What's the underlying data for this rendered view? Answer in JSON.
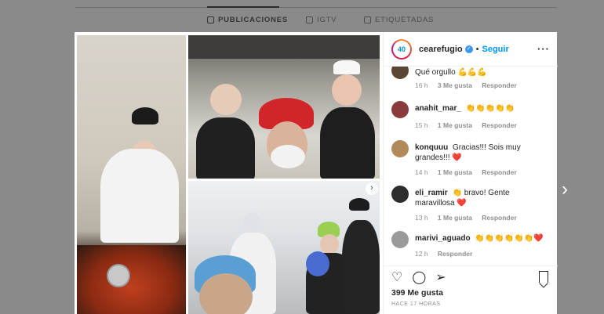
{
  "profile_tabs": {
    "publications": "PUBLICACIONES",
    "igtv": "IGTV",
    "tagged": "ETIQUETADAS"
  },
  "post": {
    "header": {
      "avatar_text": "40",
      "username": "cearefugio",
      "verified_glyph": "✓",
      "separator": "•",
      "follow_label": "Seguir",
      "more_glyph": "···"
    },
    "comments": [
      {
        "username": "",
        "text": "Qué orgullo 💪💪💪",
        "time": "16 h",
        "likes": "3 Me gusta",
        "reply": "Responder",
        "avatar_color": "#5a4634"
      },
      {
        "username": "anahit_mar_",
        "text": "👏👏👏👏👏",
        "time": "15 h",
        "likes": "1 Me gusta",
        "reply": "Responder",
        "avatar_color": "#8a3b3b"
      },
      {
        "username": "konquuu",
        "text": "Gracias!!! Sois muy grandes!!! ❤️",
        "time": "14 h",
        "likes": "1 Me gusta",
        "reply": "Responder",
        "avatar_color": "#b08a5a"
      },
      {
        "username": "eli_ramir",
        "text": "👏 bravo! Gente maravillosa ❤️",
        "time": "13 h",
        "likes": "1 Me gusta",
        "reply": "Responder",
        "avatar_color": "#2d2d2d"
      },
      {
        "username": "marivi_aguado",
        "text": "👏👏👏👏👏👏❤️",
        "time": "12 h",
        "likes": "",
        "reply": "Responder",
        "avatar_color": "#9a9a9a"
      }
    ],
    "actions": {
      "like_icon": "heart-icon",
      "comment_icon": "comment-icon",
      "share_icon": "share-icon",
      "save_icon": "bookmark-icon",
      "likes_count": "399 Me gusta",
      "timestamp": "HACE 17 HORAS"
    },
    "carousel_arrow": "›",
    "next_post_arrow": "›"
  },
  "colors": {
    "link_blue": "#0095f6",
    "verified_blue": "#3897f0",
    "text_dark": "#262626",
    "text_muted": "#8e8e8e"
  }
}
